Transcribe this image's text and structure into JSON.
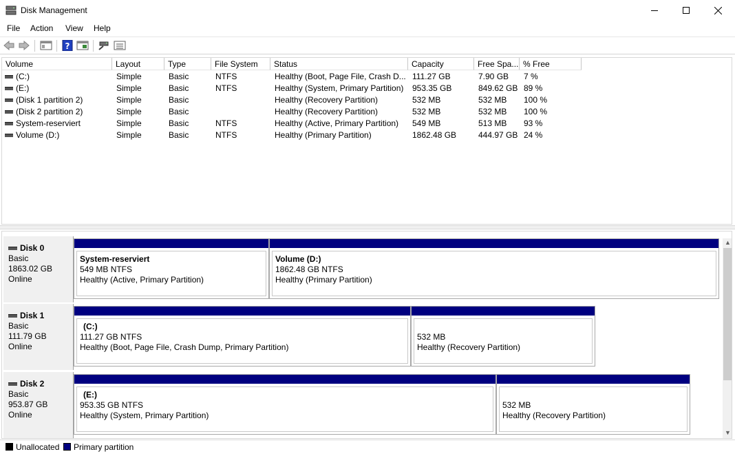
{
  "window": {
    "title": "Disk Management"
  },
  "menu": {
    "items": [
      "File",
      "Action",
      "View",
      "Help"
    ]
  },
  "toolbar": {
    "buttons": [
      "back-icon",
      "forward-icon",
      "show-hide-console-tree-icon",
      "help-icon",
      "properties-icon",
      "connect-icon",
      "console-list-icon"
    ]
  },
  "volumes": {
    "headers": [
      "Volume",
      "Layout",
      "Type",
      "File System",
      "Status",
      "Capacity",
      "Free Spa...",
      "% Free"
    ],
    "rows": [
      {
        "volume": "(C:)",
        "layout": "Simple",
        "type": "Basic",
        "fs": "NTFS",
        "status": "Healthy (Boot, Page File, Crash D...",
        "capacity": "111.27 GB",
        "free": "7.90 GB",
        "pct": "7 %"
      },
      {
        "volume": "(E:)",
        "layout": "Simple",
        "type": "Basic",
        "fs": "NTFS",
        "status": "Healthy (System, Primary Partition)",
        "capacity": "953.35 GB",
        "free": "849.62 GB",
        "pct": "89 %"
      },
      {
        "volume": "(Disk 1 partition 2)",
        "layout": "Simple",
        "type": "Basic",
        "fs": "",
        "status": "Healthy (Recovery Partition)",
        "capacity": "532 MB",
        "free": "532 MB",
        "pct": "100 %"
      },
      {
        "volume": "(Disk 2 partition 2)",
        "layout": "Simple",
        "type": "Basic",
        "fs": "",
        "status": "Healthy (Recovery Partition)",
        "capacity": "532 MB",
        "free": "532 MB",
        "pct": "100 %"
      },
      {
        "volume": "System-reserviert",
        "layout": "Simple",
        "type": "Basic",
        "fs": "NTFS",
        "status": "Healthy (Active, Primary Partition)",
        "capacity": "549 MB",
        "free": "513 MB",
        "pct": "93 %"
      },
      {
        "volume": "Volume (D:)",
        "layout": "Simple",
        "type": "Basic",
        "fs": "NTFS",
        "status": "Healthy (Primary Partition)",
        "capacity": "1862.48 GB",
        "free": "444.97 GB",
        "pct": "24 %"
      }
    ]
  },
  "disks": [
    {
      "name": "Disk 0",
      "type": "Basic",
      "size": "1863.02 GB",
      "state": "Online",
      "partitions": [
        {
          "name": "System-reserviert",
          "size": "549 MB NTFS",
          "status": "Healthy (Active, Primary Partition)"
        },
        {
          "name": "Volume  (D:)",
          "size": "1862.48 GB NTFS",
          "status": "Healthy (Primary Partition)"
        }
      ]
    },
    {
      "name": "Disk 1",
      "type": "Basic",
      "size": "111.79 GB",
      "state": "Online",
      "partitions": [
        {
          "name": "(C:)",
          "size": "111.27 GB NTFS",
          "status": "Healthy (Boot, Page File, Crash Dump, Primary Partition)"
        },
        {
          "name": "",
          "size": "532 MB",
          "status": "Healthy (Recovery Partition)"
        }
      ]
    },
    {
      "name": "Disk 2",
      "type": "Basic",
      "size": "953.87 GB",
      "state": "Online",
      "partitions": [
        {
          "name": "(E:)",
          "size": "953.35 GB NTFS",
          "status": "Healthy (System, Primary Partition)"
        },
        {
          "name": "",
          "size": "532 MB",
          "status": "Healthy (Recovery Partition)"
        }
      ]
    }
  ],
  "legend": {
    "unallocated": "Unallocated",
    "primary": "Primary partition",
    "unallocated_color": "#000000",
    "primary_color": "#000080"
  }
}
